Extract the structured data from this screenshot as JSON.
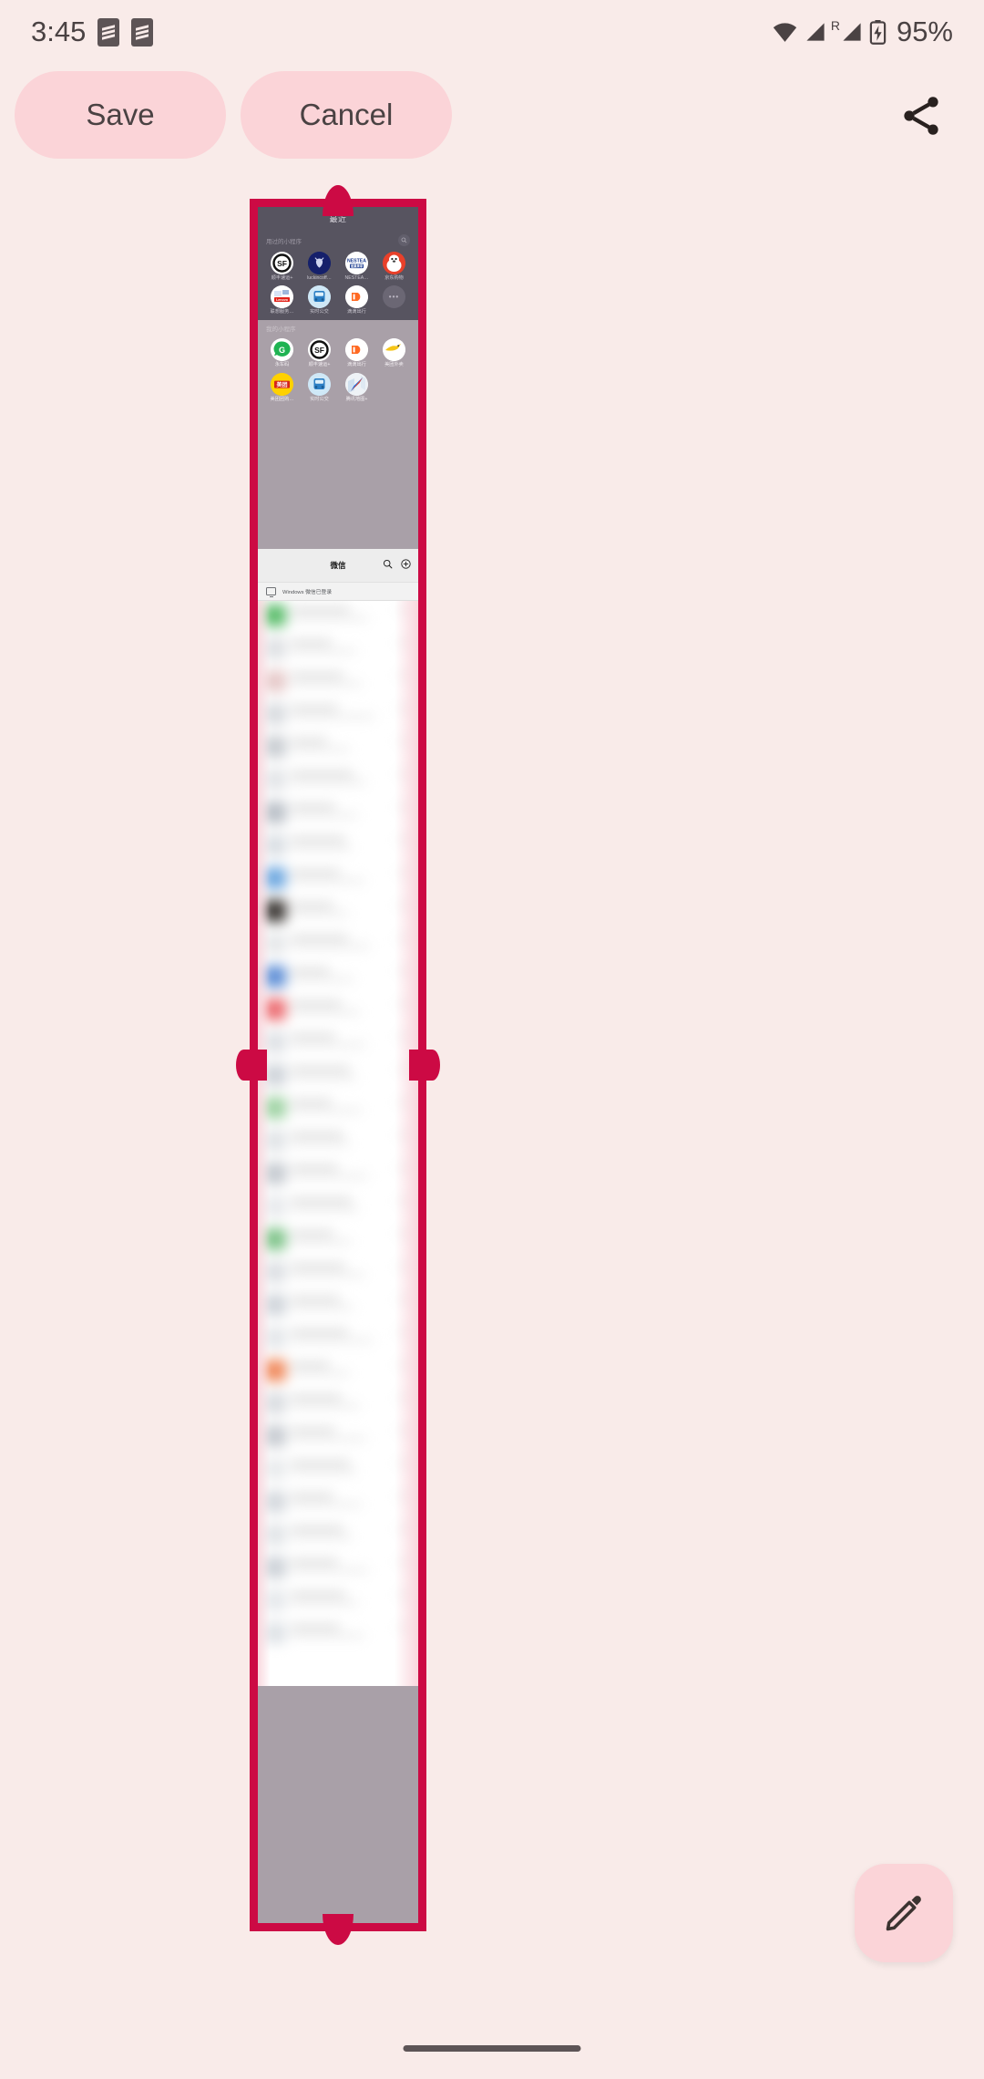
{
  "status_bar": {
    "clock": "3:45",
    "battery_percent": "95%",
    "roaming_mark": "R",
    "icons": [
      "notification-badge-icon",
      "notification-badge-icon",
      "wifi-icon",
      "signal-icon",
      "signal-icon",
      "battery-charging-icon"
    ]
  },
  "action_bar": {
    "save_label": "Save",
    "cancel_label": "Cancel",
    "share_icon": "share-icon"
  },
  "crop_editor": {
    "frame_color": "#cc0a44",
    "handles": [
      "handle-top",
      "handle-bottom",
      "handle-left",
      "handle-right"
    ]
  },
  "captured_screenshot": {
    "miniprogram_panel": {
      "title": "最近",
      "recent_section": {
        "label": "用过的小程序",
        "search_icon": "search-icon",
        "apps": [
          {
            "name": "顺丰速运+",
            "icon": "sf-express-icon",
            "bg": "#ffffff",
            "glyph": "SF"
          },
          {
            "name": "luckincoff…",
            "icon": "luckin-coffee-icon",
            "bg": "#15206b",
            "glyph": "🦌"
          },
          {
            "name": "NESTEA…",
            "icon": "nestea-icon",
            "bg": "#ffffff",
            "glyph": "N"
          },
          {
            "name": "京东购物",
            "icon": "jd-shopping-icon",
            "bg": "#e8402a",
            "glyph": "JD"
          },
          {
            "name": "联想服务…",
            "icon": "lenovo-service-icon",
            "bg": "#ffffff",
            "glyph": "L"
          },
          {
            "name": "实时公交",
            "icon": "realtime-bus-icon",
            "bg": "#cfe8f7",
            "glyph": "BUS"
          },
          {
            "name": "滴滴出行",
            "icon": "didi-icon",
            "bg": "#ffffff",
            "glyph": "D"
          },
          {
            "name": "",
            "icon": "more-ellipsis-icon",
            "bg": "#6b6774",
            "glyph": "…"
          }
        ]
      },
      "my_section": {
        "label": "我的小程序",
        "apps": [
          {
            "name": "永车码",
            "icon": "green-chat-icon",
            "bg": "#ffffff",
            "glyph": "G"
          },
          {
            "name": "顺丰速运+",
            "icon": "sf-express-icon",
            "bg": "#ffffff",
            "glyph": "SF"
          },
          {
            "name": "滴滴出行",
            "icon": "didi-icon",
            "bg": "#ffffff",
            "glyph": "D"
          },
          {
            "name": "美团外卖",
            "icon": "meituan-waimai-icon",
            "bg": "#ffffff",
            "glyph": "K"
          },
          {
            "name": "美团团购…",
            "icon": "meituan-icon",
            "bg": "#ffd100",
            "glyph": "美团"
          },
          {
            "name": "实时公交",
            "icon": "realtime-bus-icon",
            "bg": "#cfe8f7",
            "glyph": "BUS"
          },
          {
            "name": "腾讯地图+",
            "icon": "tencent-map-icon",
            "bg": "#ffffff",
            "glyph": "M"
          }
        ]
      }
    },
    "wechat": {
      "title": "微信",
      "search_icon": "search-icon",
      "add_icon": "plus-circle-icon",
      "desktop_status": "Windows 微信已登录",
      "monitor_icon": "monitor-icon",
      "chat_list_note": "blurred-chat-list"
    }
  },
  "fab": {
    "icon": "pencil-edit-icon",
    "color": "#fbd4d8"
  },
  "nav_bar": {
    "gesture_handle": "home-gesture-bar"
  }
}
